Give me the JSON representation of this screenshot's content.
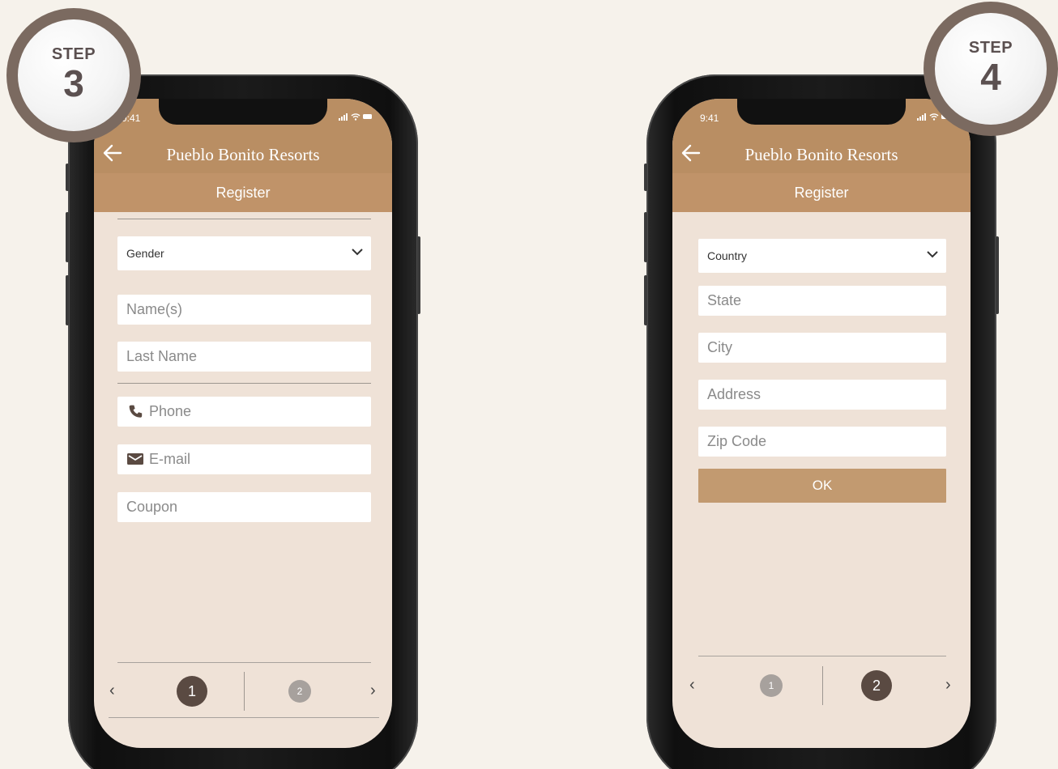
{
  "steps": [
    {
      "label": "STEP",
      "number": "3"
    },
    {
      "label": "STEP",
      "number": "4"
    }
  ],
  "left_screen": {
    "status_time": "9:41",
    "app_title": "Pueblo Bonito Resorts",
    "page_title": "Register",
    "gender_select": "Gender",
    "fields": {
      "names": "Name(s)",
      "last_name": "Last Name",
      "phone": "Phone",
      "email": "E-mail",
      "coupon": "Coupon"
    },
    "pager": {
      "prev": "‹",
      "next": "›",
      "page1": "1",
      "page2": "2",
      "active": 1
    }
  },
  "right_screen": {
    "status_time": "9:41",
    "app_title": "Pueblo Bonito Resorts",
    "page_title": "Register",
    "country_select": "Country",
    "fields": {
      "state": "State",
      "city": "City",
      "address": "Address",
      "zip": "Zip Code"
    },
    "ok_label": "OK",
    "pager": {
      "prev": "‹",
      "next": "›",
      "page1": "1",
      "page2": "2",
      "active": 2
    }
  },
  "colors": {
    "header": "#b98e63",
    "subheader": "#c09369",
    "screen_bg": "#efe2d7",
    "ok_button": "#c29a70",
    "badge_ring": "#7b6a60",
    "page_background": "#f6f2eb"
  },
  "icons": [
    "back-arrow-icon",
    "chevron-down-icon",
    "phone-icon",
    "mail-icon",
    "signal-icon",
    "wifi-icon",
    "battery-icon"
  ]
}
